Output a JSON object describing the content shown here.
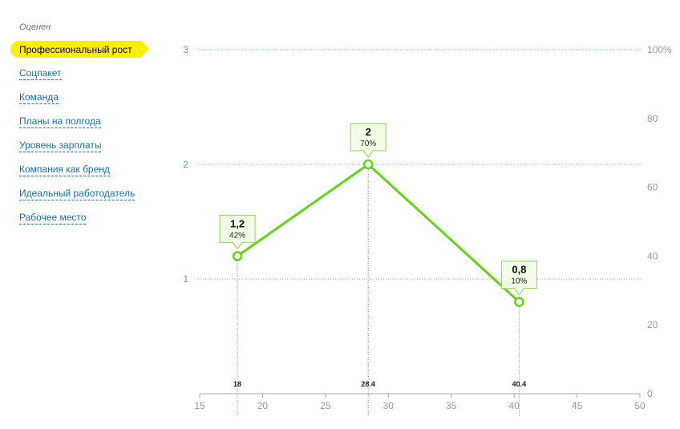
{
  "sidebar": {
    "heading": "Оценен",
    "items": [
      {
        "label": "Профессиональный рост",
        "active": true
      },
      {
        "label": "Соцпакет",
        "active": false
      },
      {
        "label": "Команда",
        "active": false
      },
      {
        "label": "Планы на полгода",
        "active": false
      },
      {
        "label": "Уровень зарплаты",
        "active": false
      },
      {
        "label": "Компания как бренд",
        "active": false
      },
      {
        "label": "Идеальный работодатель",
        "active": false
      },
      {
        "label": "Рабочее место",
        "active": false
      }
    ]
  },
  "colors": {
    "line": "#66d21a",
    "callout_bg": "#f2fbe6",
    "grid": "#6db3e0",
    "left_ticks": "#5a9fd0",
    "axis": "#aaaaaa",
    "active_pill": "#ffee00"
  },
  "chart_data": {
    "type": "line",
    "x": [
      18,
      28.4,
      40.4
    ],
    "x_labels": [
      "18",
      "28.4",
      "40.4"
    ],
    "y": [
      1.2,
      2,
      0.8
    ],
    "value_labels": [
      "1,2",
      "2",
      "0,8"
    ],
    "percent_labels": [
      "42%",
      "70%",
      "10%"
    ],
    "xlim": [
      15,
      50
    ],
    "ylim": [
      0,
      3
    ],
    "x_ticks": [
      "15",
      "20",
      "25",
      "30",
      "35",
      "40",
      "45",
      "50"
    ],
    "y_ticks_left": [
      "1",
      "2",
      "3"
    ],
    "y2lim": [
      0,
      100
    ],
    "y_ticks_right": [
      "0",
      "20",
      "40",
      "60",
      "80",
      "100%"
    ],
    "grid": true
  }
}
